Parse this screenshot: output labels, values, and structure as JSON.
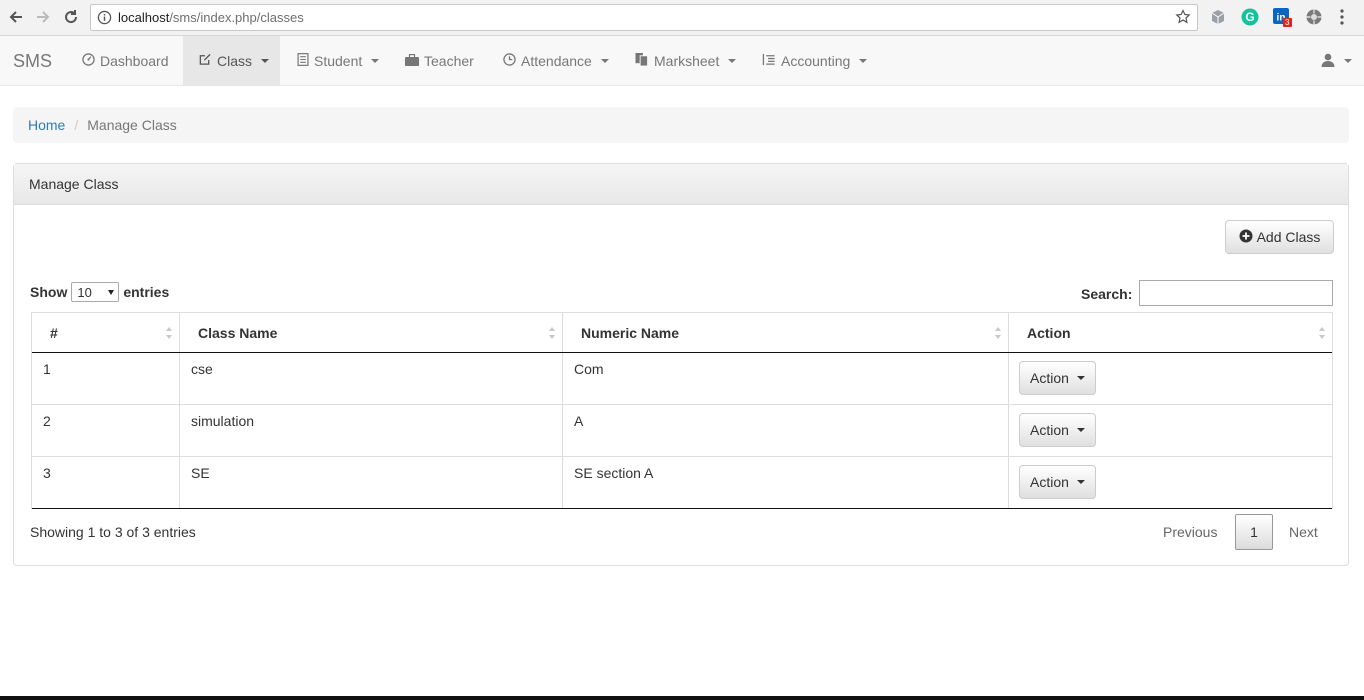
{
  "browser": {
    "url_host": "localhost",
    "url_path": "/sms/index.php/classes",
    "linkedin_badge": "3"
  },
  "navbar": {
    "brand": "SMS",
    "items": [
      {
        "label": "Dashboard",
        "icon": "dashboard-icon"
      },
      {
        "label": "Class",
        "icon": "edit-icon",
        "active": true
      },
      {
        "label": "Student",
        "icon": "list-icon"
      },
      {
        "label": "Teacher",
        "icon": "briefcase-icon"
      },
      {
        "label": "Attendance",
        "icon": "clock-icon"
      },
      {
        "label": "Marksheet",
        "icon": "documents-icon"
      },
      {
        "label": "Accounting",
        "icon": "indent-icon"
      }
    ],
    "user_icon": "user-icon"
  },
  "breadcrumb": {
    "home": "Home",
    "separator": "/",
    "current": "Manage Class"
  },
  "panel": {
    "title": "Manage Class",
    "add_button": "Add Class",
    "show_label": "Show",
    "entries_value": "10",
    "entries_label": "entries",
    "search_label": "Search:",
    "search_value": ""
  },
  "table": {
    "headers": [
      "#",
      "Class Name",
      "Numeric Name",
      "Action"
    ],
    "rows": [
      {
        "num": "1",
        "class_name": "cse",
        "numeric_name": "Com",
        "action": "Action"
      },
      {
        "num": "2",
        "class_name": "simulation",
        "numeric_name": "A",
        "action": "Action"
      },
      {
        "num": "3",
        "class_name": "SE",
        "numeric_name": "SE section A",
        "action": "Action"
      }
    ]
  },
  "footer": {
    "info": "Showing 1 to 3 of 3 entries",
    "previous": "Previous",
    "page": "1",
    "next": "Next"
  },
  "colors": {
    "link": "#337ab7",
    "navbar_bg": "#f8f8f8",
    "active_bg": "#e7e7e7"
  }
}
